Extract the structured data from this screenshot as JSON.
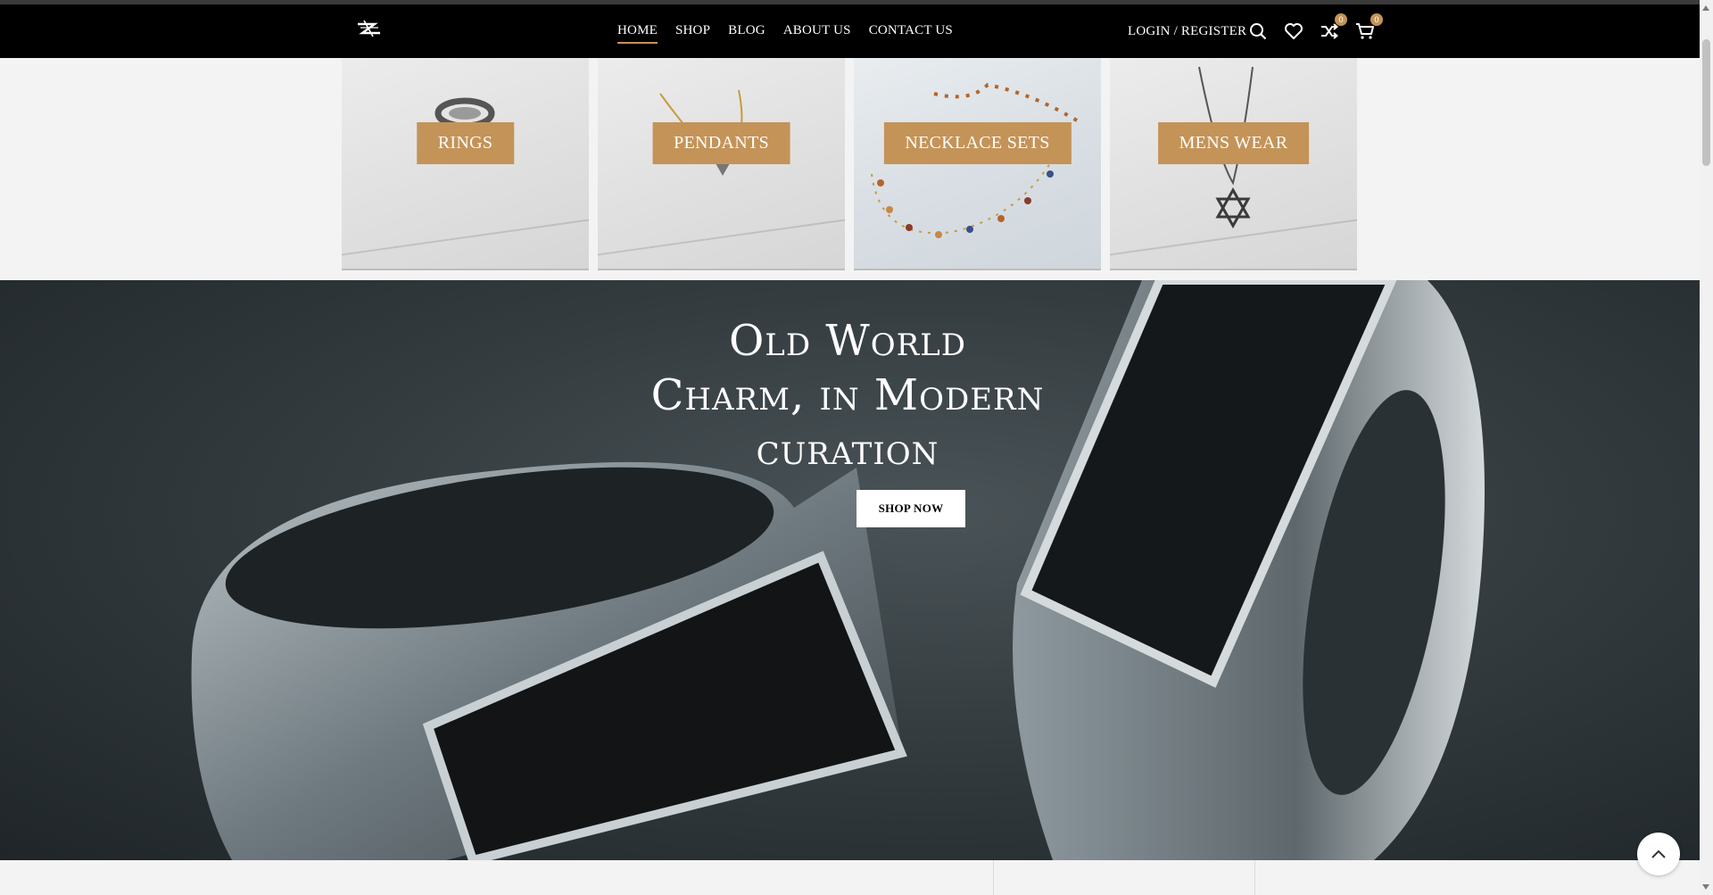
{
  "header": {
    "nav": [
      {
        "label": "HOME",
        "active": true
      },
      {
        "label": "SHOP"
      },
      {
        "label": "BLOG"
      },
      {
        "label": "ABOUT US"
      },
      {
        "label": "CONTACT US"
      }
    ],
    "login_label": "LOGIN / REGISTER",
    "compare_count": "0",
    "cart_count": "0"
  },
  "categories": [
    {
      "label": "RINGS"
    },
    {
      "label": "PENDANTS"
    },
    {
      "label": "NECKLACE SETS"
    },
    {
      "label": "MENS WEAR"
    }
  ],
  "hero": {
    "title_line1": "Old World",
    "title_line2": "Charm, in Modern",
    "title_line3": "curation",
    "button_label": "SHOP NOW"
  },
  "icons": {
    "search": "search-icon",
    "wishlist": "heart-icon",
    "compare": "shuffle-icon",
    "cart": "cart-icon",
    "scroll_top": "chevron-up-icon"
  },
  "colors": {
    "accent": "#c49358",
    "header_bg": "#000000"
  }
}
